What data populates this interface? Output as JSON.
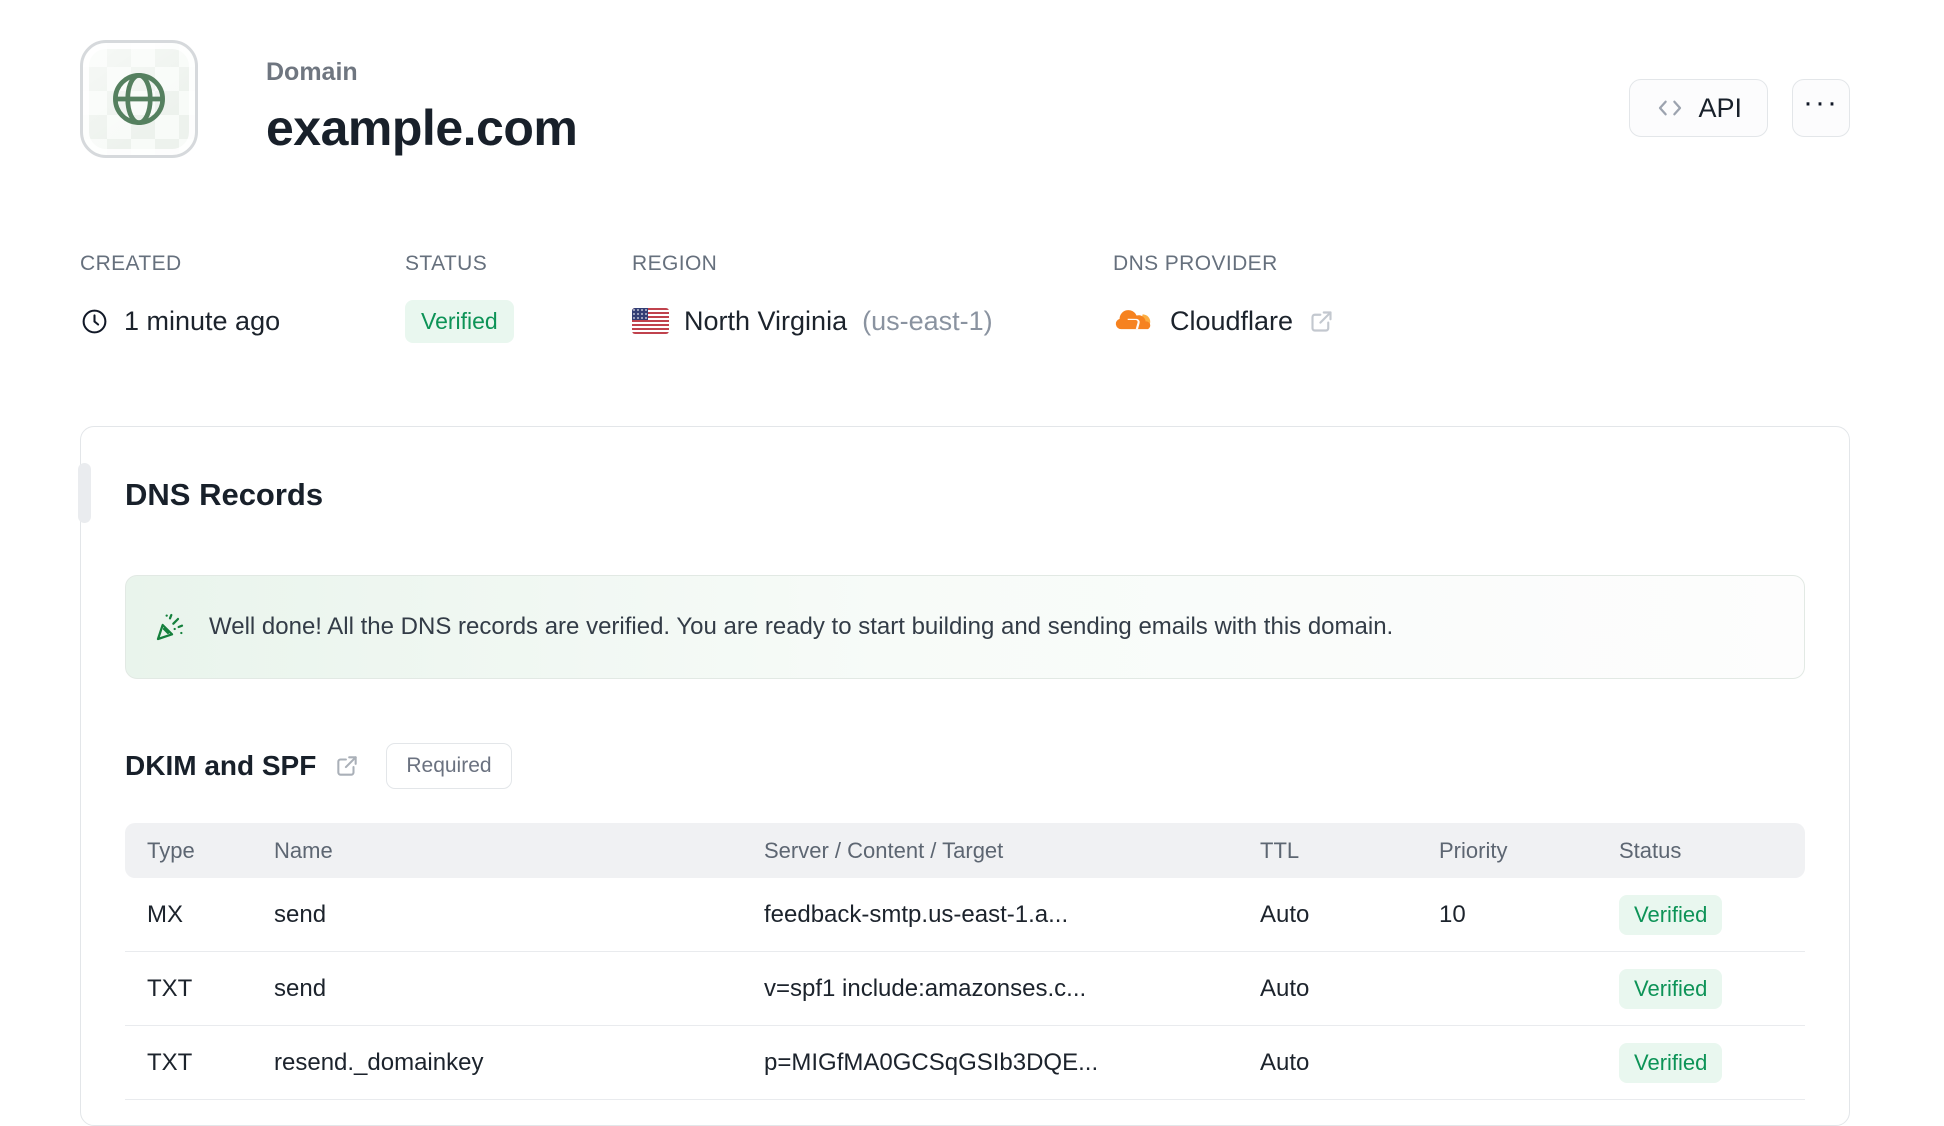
{
  "header": {
    "eyebrow": "Domain",
    "title": "example.com",
    "api_button_label": "API",
    "more_button_label": "···"
  },
  "meta": {
    "created": {
      "label": "CREATED",
      "value": "1 minute ago"
    },
    "status": {
      "label": "STATUS",
      "value": "Verified"
    },
    "region": {
      "label": "REGION",
      "value": "North Virginia",
      "code": "(us-east-1)"
    },
    "dns_provider": {
      "label": "DNS PROVIDER",
      "value": "Cloudflare"
    }
  },
  "dns_card": {
    "title": "DNS Records",
    "banner_message": "Well done! All the DNS records are verified. You are ready to start building and sending emails with this domain.",
    "section": {
      "title": "DKIM and SPF",
      "badge": "Required"
    },
    "table": {
      "headers": [
        "Type",
        "Name",
        "Server / Content / Target",
        "TTL",
        "Priority",
        "Status"
      ],
      "rows": [
        {
          "type": "MX",
          "name": "send",
          "content": "feedback-smtp.us-east-1.a...",
          "ttl": "Auto",
          "priority": "10",
          "status": "Verified"
        },
        {
          "type": "TXT",
          "name": "send",
          "content": "v=spf1 include:amazonses.c...",
          "ttl": "Auto",
          "priority": "",
          "status": "Verified"
        },
        {
          "type": "TXT",
          "name": "resend._domainkey",
          "content": "p=MIGfMA0GCSqGSIb3DQE...",
          "ttl": "Auto",
          "priority": "",
          "status": "Verified"
        }
      ]
    }
  },
  "colors": {
    "verified_text": "#0d9357",
    "verified_bg": "#e9f7ef",
    "globe_green": "#55805f",
    "banner_green": "#15803d",
    "cloudflare_orange": "#f6821f",
    "cloudflare_light_orange": "#fbad41",
    "border_gray": "#e3e6e9"
  }
}
